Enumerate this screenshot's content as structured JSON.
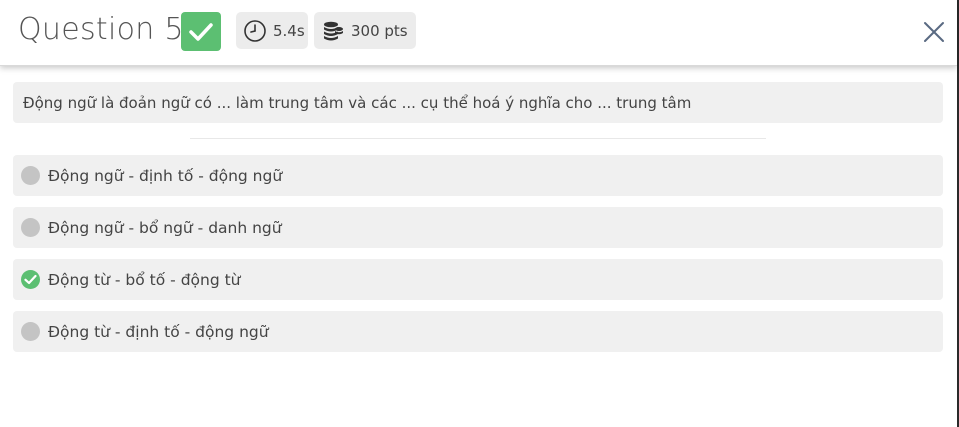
{
  "header": {
    "title": "Question 5",
    "status": "correct",
    "timer": "5.4s",
    "points": "300 pts"
  },
  "question": {
    "text": "Động ngữ là đoản ngữ có ... làm trung tâm và các ... cụ thể hoá ý nghĩa cho ... trung tâm"
  },
  "options": [
    {
      "label": "Động ngữ - định tố - động ngữ",
      "state": "unselected"
    },
    {
      "label": "Động ngữ - bổ ngữ - danh ngữ",
      "state": "unselected"
    },
    {
      "label": "Động từ - bổ tố - động từ",
      "state": "correct"
    },
    {
      "label": "Động từ - định tố - động ngữ",
      "state": "unselected"
    }
  ],
  "colors": {
    "correct_green": "#5cbf72",
    "option_bg": "#f0f0f0",
    "chip_bg": "#ececec",
    "unselected_marker": "#c4c4c4",
    "close_icon": "#5a6a82"
  },
  "icons": {
    "status": "check-icon",
    "timer": "clock-icon",
    "points": "coins-icon",
    "close": "close-icon"
  }
}
